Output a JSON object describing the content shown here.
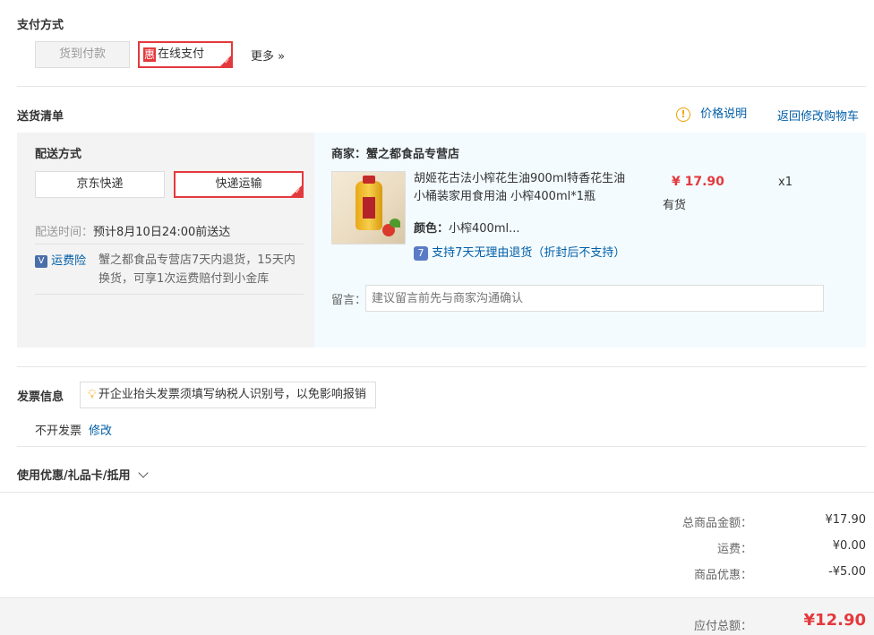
{
  "payment": {
    "title": "支付方式",
    "cod_label": "货到付款",
    "online_badge": "惠",
    "online_label": "在线支付",
    "more_label": "更多 »"
  },
  "delivery": {
    "title": "送货清单",
    "price_note_label": "价格说明",
    "back_to_cart_label": "返回修改购物车",
    "method_title": "配送方式",
    "option_jd": "京东快递",
    "option_express": "快递运输",
    "time_label": "配送时间：",
    "time_value": "预计8月10日24:00前送达",
    "insurance_label": "运费险",
    "insurance_text": "蟹之都食品专营店7天内退货，15天内换货，可享1次运费赔付到小金库"
  },
  "merchant": {
    "label": "商家：蟹之都食品专营店",
    "product_name": "胡姬花古法小榨花生油900ml特香花生油小桶装家用食用油 小榨400ml*1瓶",
    "price": "¥ 17.90",
    "stock": "有货",
    "quantity": "x1",
    "color_label": "颜色：",
    "color_value": "小榨400ml...",
    "return_policy": "支持7天无理由退货（折封后不支持）",
    "message_label": "留言：",
    "message_placeholder": "建议留言前先与商家沟通确认"
  },
  "invoice": {
    "title": "发票信息",
    "tip": "开企业抬头发票须填写纳税人识别号，以免影响报销",
    "status": "不开发票",
    "edit_label": "修改"
  },
  "coupon": {
    "title": "使用优惠/礼品卡/抵用"
  },
  "summary": {
    "goods_total_label": "总商品金额：",
    "goods_total_value": "¥17.90",
    "shipping_label": "运费：",
    "shipping_value": "¥0.00",
    "discount_label": "商品优惠：",
    "discount_value": "-¥5.00",
    "payable_label": "应付总额：",
    "payable_value": "¥12.90"
  },
  "colors": {
    "accent": "#e4393c",
    "link": "#005ea7",
    "panel_left": "#f3f3f3",
    "panel_right": "#f3fbfe"
  }
}
